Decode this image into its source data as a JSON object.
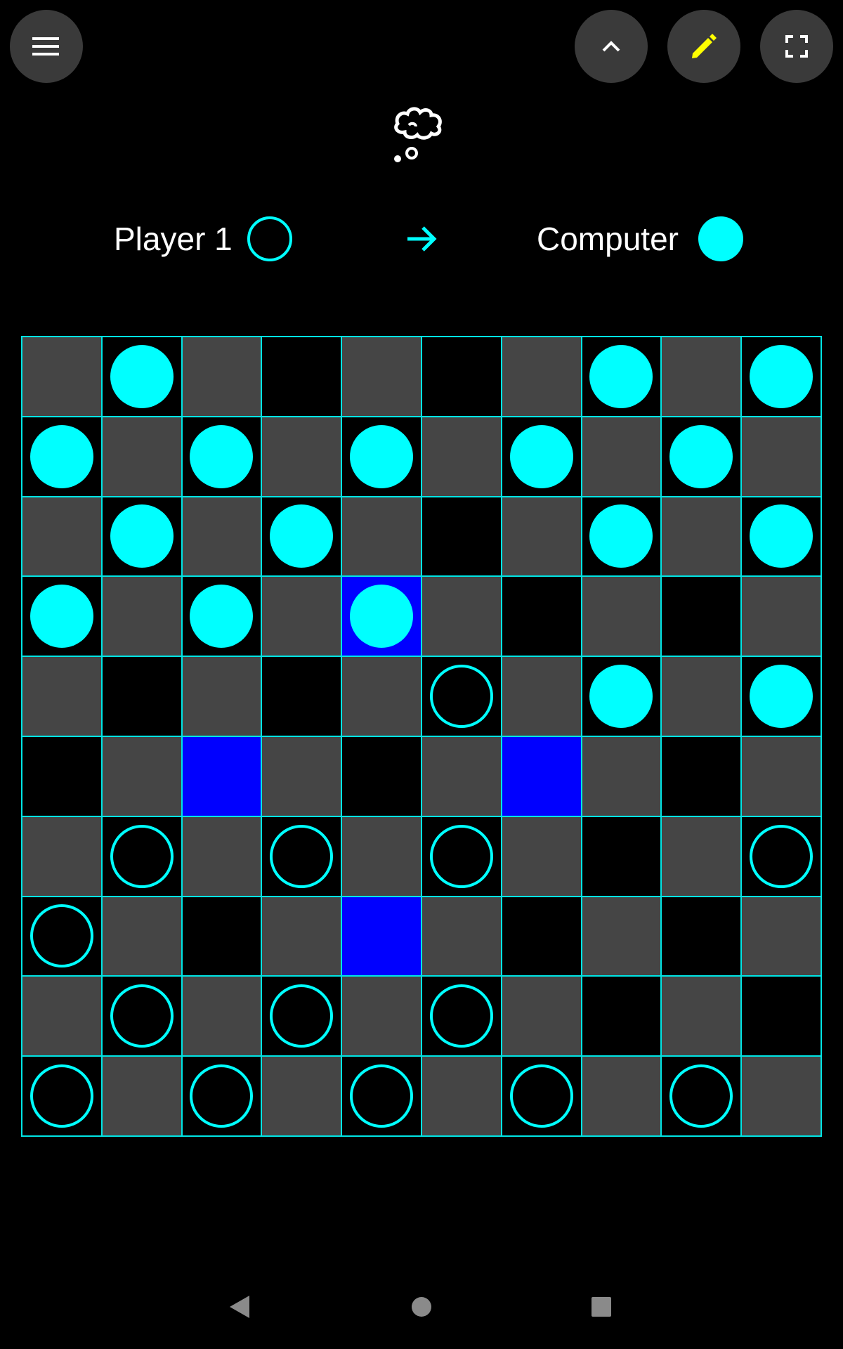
{
  "header": {
    "menu_icon": "hamburger-menu-icon",
    "collapse_icon": "chevron-up-icon",
    "edit_icon": "pencil-icon",
    "fullscreen_icon": "fullscreen-icon",
    "status_icon": "thought-bubble-icon"
  },
  "players": {
    "player1": {
      "name": "Player 1",
      "piece": "hollow"
    },
    "player2": {
      "name": "Computer",
      "piece": "filled"
    },
    "turn_indicator": "arrow-right-icon"
  },
  "colors": {
    "background": "#000000",
    "accent": "#00ffff",
    "light_square": "#454545",
    "dark_square": "#000000",
    "highlight_square": "#0000ff",
    "button": "#3a3a3a",
    "edit_icon": "#ffff00"
  },
  "board": {
    "size": 10,
    "squares": [
      "LDLDLDLDLD",
      "DLDLDLDLDL",
      "LDLDLDLDLD",
      "DLDLHLDLDL",
      "LDLDLDLDLD",
      "DLHLDLHLDL",
      "LDLDLDLDLD",
      "DLDLHLDLDL",
      "LDLDLDLDLD",
      "DLDLDLDLDL"
    ],
    "pieces": [
      ".F.....F.F",
      "F.F.F.F.F.",
      ".F.F...F.F",
      "F.F.F.....",
      ".....O.F.F",
      "..........",
      ".O.O.O...O",
      "O.........",
      ".O.O.O....",
      "O.O.O.O.O."
    ],
    "legend": {
      "F": "computer-piece",
      "O": "player1-piece",
      ".": "empty"
    }
  },
  "navbar": {
    "back_icon": "nav-back-icon",
    "home_icon": "nav-home-icon",
    "recents_icon": "nav-recents-icon"
  }
}
